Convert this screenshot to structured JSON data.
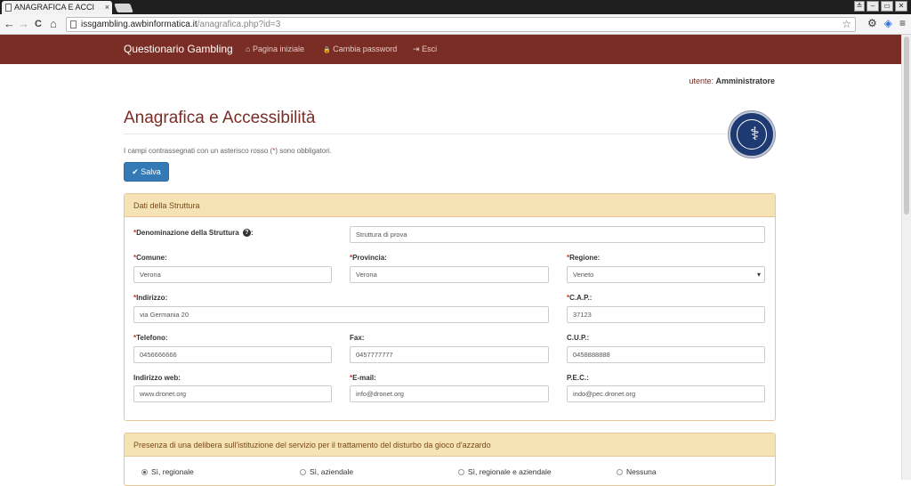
{
  "browser": {
    "tab_title": "ANAGRAFICA E ACCI",
    "tab_close": "×",
    "url_host": "issgambling.awbinformatica.it",
    "url_path": "/anagrafica.php?id=3",
    "win_user": "≗",
    "win_min": "–",
    "win_max": "▭",
    "win_close": "✕",
    "back": "←",
    "forward": "→",
    "reload": "C",
    "home": "⌂",
    "star": "☆",
    "settings": "⚙",
    "extension": "◈",
    "menu": "≡"
  },
  "navbar": {
    "brand": "Questionario Gambling",
    "links": [
      {
        "label": "Pagina iniziale",
        "icon": "home-icon",
        "glyph": "⌂"
      },
      {
        "label": "Cambia password",
        "icon": "lock-icon",
        "glyph": "🔒"
      },
      {
        "label": "Esci",
        "icon": "logout-icon",
        "glyph": "⇥"
      }
    ]
  },
  "user": {
    "prefix": "utente:",
    "name": "Amministratore"
  },
  "page": {
    "title": "Anagrafica e Accessibilità",
    "note_before": "I campi contrassegnati con un asterisco rosso (",
    "note_ast": "*",
    "note_after": ") sono obbligatori.",
    "save_label": "Salva",
    "save_glyph": "✔"
  },
  "panel1": {
    "heading": "Dati della Struttura",
    "fields": {
      "denominazione": {
        "label": "Denominazione della Struttura",
        "suffix": ":",
        "required": "*",
        "help": "?",
        "value": "Struttura di prova"
      },
      "comune": {
        "label": "Comune:",
        "required": "*",
        "value": "Verona"
      },
      "provincia": {
        "label": "Provincia:",
        "required": "*",
        "value": "Verona"
      },
      "regione": {
        "label": "Regione:",
        "required": "*",
        "value": "Veneto"
      },
      "indirizzo": {
        "label": "Indirizzo:",
        "required": "*",
        "value": "via Germania 20"
      },
      "cap": {
        "label": "C.A.P.:",
        "required": "*",
        "value": "37123"
      },
      "telefono": {
        "label": "Telefono:",
        "required": "*",
        "value": "0456666666"
      },
      "fax": {
        "label": "Fax:",
        "value": "0457777777"
      },
      "cup": {
        "label": "C.U.P.:",
        "value": "0458888888"
      },
      "web": {
        "label": "Indirizzo web:",
        "value": "www.dronet.org"
      },
      "email": {
        "label": "E-mail:",
        "required": "*",
        "value": "info@dronet.org"
      },
      "pec": {
        "label": "P.E.C.:",
        "value": "indo@pec.dronet.org"
      }
    }
  },
  "panel2": {
    "heading": "Presenza di una delibera sull'istituzione del servizio per il trattamento del disturbo da gioco d'azzardo",
    "options": [
      {
        "label": "Sì, regionale",
        "selected": true
      },
      {
        "label": "Sì, aziendale",
        "selected": false
      },
      {
        "label": "Sì, regionale e aziendale",
        "selected": false
      },
      {
        "label": "Nessuna",
        "selected": false
      }
    ]
  }
}
